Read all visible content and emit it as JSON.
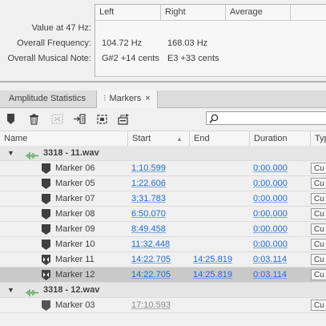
{
  "freq": {
    "labels": [
      "Value at 47 Hz:",
      "Overall Frequency:",
      "Overall Musical Note:"
    ],
    "columns": [
      "Left",
      "Right",
      "Average"
    ],
    "rows": [
      [
        "",
        "",
        ""
      ],
      [
        "104.72 Hz",
        "168.03 Hz",
        ""
      ],
      [
        "G#2 +14 cents",
        "E3 +33 cents",
        ""
      ]
    ]
  },
  "tabs": [
    {
      "label": "Amplitude Statistics"
    },
    {
      "label": "Markers",
      "close": "×"
    }
  ],
  "toolbar": {
    "icons": [
      "marker-icon",
      "trash-icon",
      "merge-icon",
      "insert-playlist-icon",
      "export-icon",
      "batch-icon"
    ]
  },
  "table": {
    "columns": [
      "Name",
      "Start",
      "End",
      "Duration",
      "Typ"
    ],
    "groups": [
      {
        "file": "3318 - 11.wav",
        "markers": [
          {
            "name": "Marker 06",
            "start": "1:10.599",
            "end": "",
            "duration": "0:00.000",
            "type": "Cu",
            "range": false
          },
          {
            "name": "Marker 05",
            "start": "1:22.606",
            "end": "",
            "duration": "0:00.000",
            "type": "Cu",
            "range": false
          },
          {
            "name": "Marker 07",
            "start": "3:31.783",
            "end": "",
            "duration": "0:00.000",
            "type": "Cu",
            "range": false
          },
          {
            "name": "Marker 08",
            "start": "6:50.070",
            "end": "",
            "duration": "0:00.000",
            "type": "Cu",
            "range": false
          },
          {
            "name": "Marker 09",
            "start": "8:49.458",
            "end": "",
            "duration": "0:00.000",
            "type": "Cu",
            "range": false
          },
          {
            "name": "Marker 10",
            "start": "11:32.448",
            "end": "",
            "duration": "0:00.000",
            "type": "Cu",
            "range": false
          },
          {
            "name": "Marker 11",
            "start": "14:22.705",
            "end": "14:25.819",
            "duration": "0:03.114",
            "type": "Cu",
            "range": true
          },
          {
            "name": "Marker 12",
            "start": "14:22.705",
            "end": "14:25.819",
            "duration": "0:03.114",
            "type": "Cu",
            "range": true,
            "selected": true
          }
        ]
      },
      {
        "file": "3318 - 12.wav",
        "markers": [
          {
            "name": "Marker 03",
            "start": "17:10.593",
            "end": "",
            "duration": "",
            "type": "Cu",
            "range": false,
            "dim": true
          }
        ]
      }
    ]
  }
}
